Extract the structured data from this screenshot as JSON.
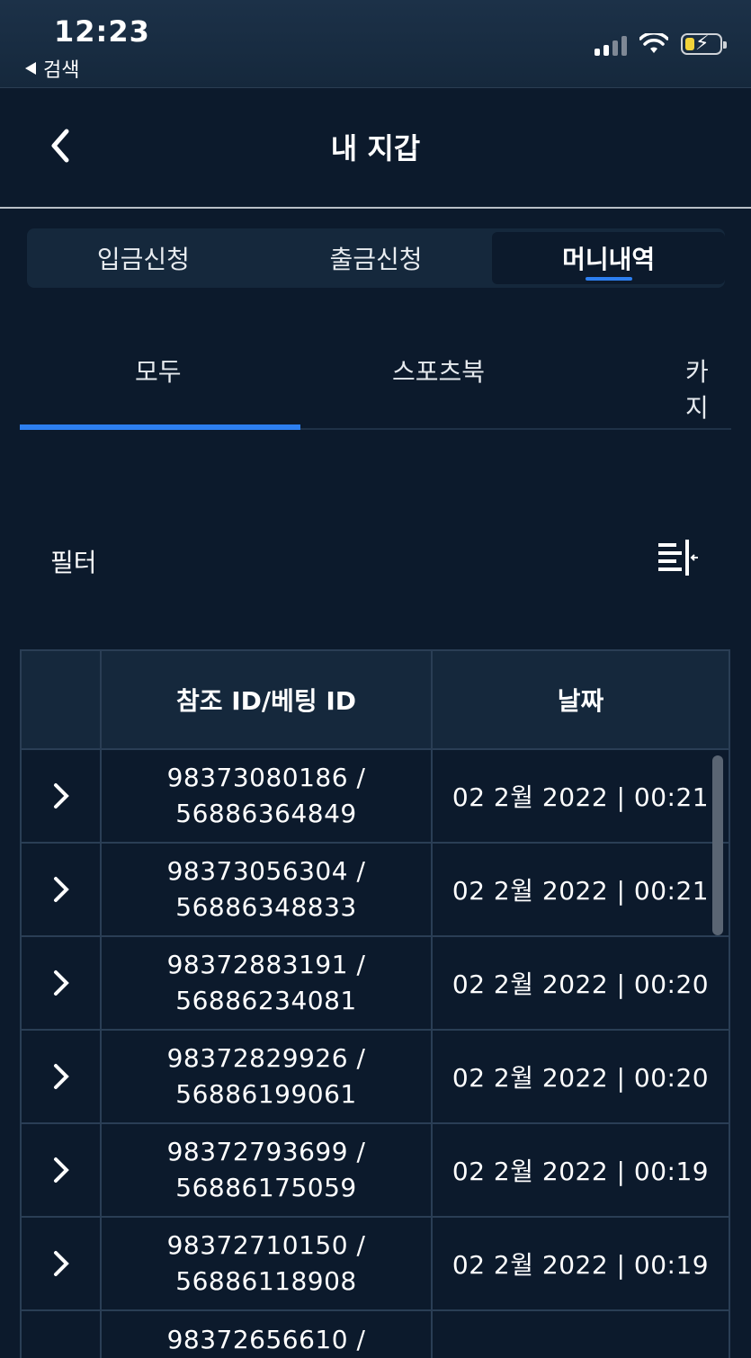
{
  "status_bar": {
    "time": "12:23",
    "back_label": "검색"
  },
  "header": {
    "title": "내 지갑"
  },
  "segment_tabs": [
    {
      "label": "입금신청",
      "active": false
    },
    {
      "label": "출금신청",
      "active": false
    },
    {
      "label": "머니내역",
      "active": true
    }
  ],
  "sub_tabs": [
    {
      "label": "모두",
      "active": true
    },
    {
      "label": "스포츠북",
      "active": false
    },
    {
      "label": "카지",
      "active": false
    }
  ],
  "filter": {
    "label": "필터",
    "icon": "filter-collapse-icon"
  },
  "table": {
    "columns": [
      "",
      "참조 ID/베팅 ID",
      "날짜"
    ],
    "rows": [
      {
        "ref_id": "98373080186 /",
        "bet_id": "56886364849",
        "date": "02 2월 2022 | 00:21"
      },
      {
        "ref_id": "98373056304 /",
        "bet_id": "56886348833",
        "date": "02 2월 2022 | 00:21"
      },
      {
        "ref_id": "98372883191 /",
        "bet_id": "56886234081",
        "date": "02 2월 2022 | 00:20"
      },
      {
        "ref_id": "98372829926 /",
        "bet_id": "56886199061",
        "date": "02 2월 2022 | 00:20"
      },
      {
        "ref_id": "98372793699 /",
        "bet_id": "56886175059",
        "date": "02 2월 2022 | 00:19"
      },
      {
        "ref_id": "98372710150 /",
        "bet_id": "56886118908",
        "date": "02 2월 2022 | 00:19"
      },
      {
        "ref_id": "98372656610 /",
        "bet_id": "",
        "date": ""
      }
    ]
  },
  "colors": {
    "background": "#0c1a2c",
    "panel": "#15283c",
    "accent": "#2d7ff0",
    "border": "#2a3e55"
  }
}
